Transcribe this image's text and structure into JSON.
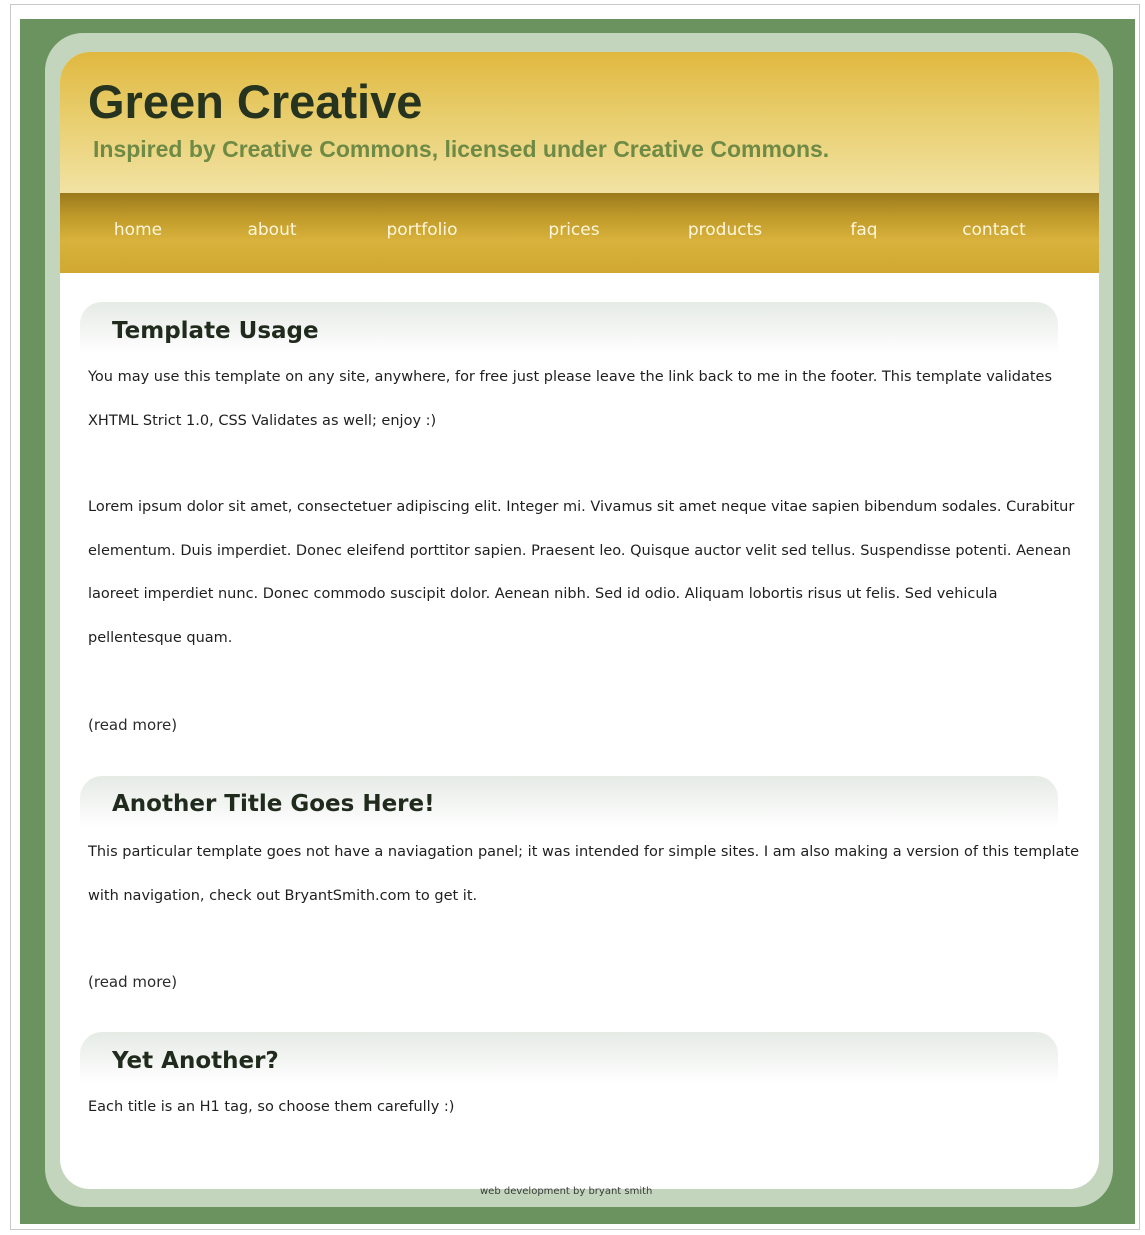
{
  "header": {
    "title": "Green Creative",
    "tagline": "Inspired by Creative Commons, licensed under Creative Commons."
  },
  "nav": {
    "items": [
      "home",
      "about",
      "portfolio",
      "prices",
      "products",
      "faq",
      "contact"
    ]
  },
  "posts": [
    {
      "title": "Template Usage",
      "paragraphs": [
        "You may use this template on any site, anywhere, for free just please leave the link back to me in the footer. This template validates XHTML Strict 1.0, CSS Validates as well; enjoy :)",
        "Lorem ipsum dolor sit amet, consectetuer adipiscing elit. Integer mi. Vivamus sit amet neque vitae sapien bibendum sodales. Curabitur elementum. Duis imperdiet. Donec eleifend porttitor sapien. Praesent leo. Quisque auctor velit sed tellus. Suspendisse potenti. Aenean laoreet imperdiet nunc. Donec commodo suscipit dolor. Aenean nibh. Sed id odio. Aliquam lobortis risus ut felis. Sed vehicula pellentesque quam."
      ],
      "read_more": "(read more)"
    },
    {
      "title": "Another Title Goes Here!",
      "paragraphs": [
        "This particular template goes not have a naviagation panel; it was intended for simple sites. I am also making a version of this template with navigation, check out BryantSmith.com to get it."
      ],
      "read_more": "(read more)"
    },
    {
      "title": "Yet Another?",
      "paragraphs": [
        "Each title is an H1 tag, so choose them carefully :)"
      ]
    }
  ],
  "footer": {
    "credit": "web development by bryant smith"
  },
  "colors": {
    "outer_green": "#6b9360",
    "ring_green": "#c3d6bd",
    "header_gold": "#e0b83f",
    "nav_gold": "#c09a2a",
    "title_dark": "#25331f",
    "tagline_green": "#6e8a45"
  }
}
